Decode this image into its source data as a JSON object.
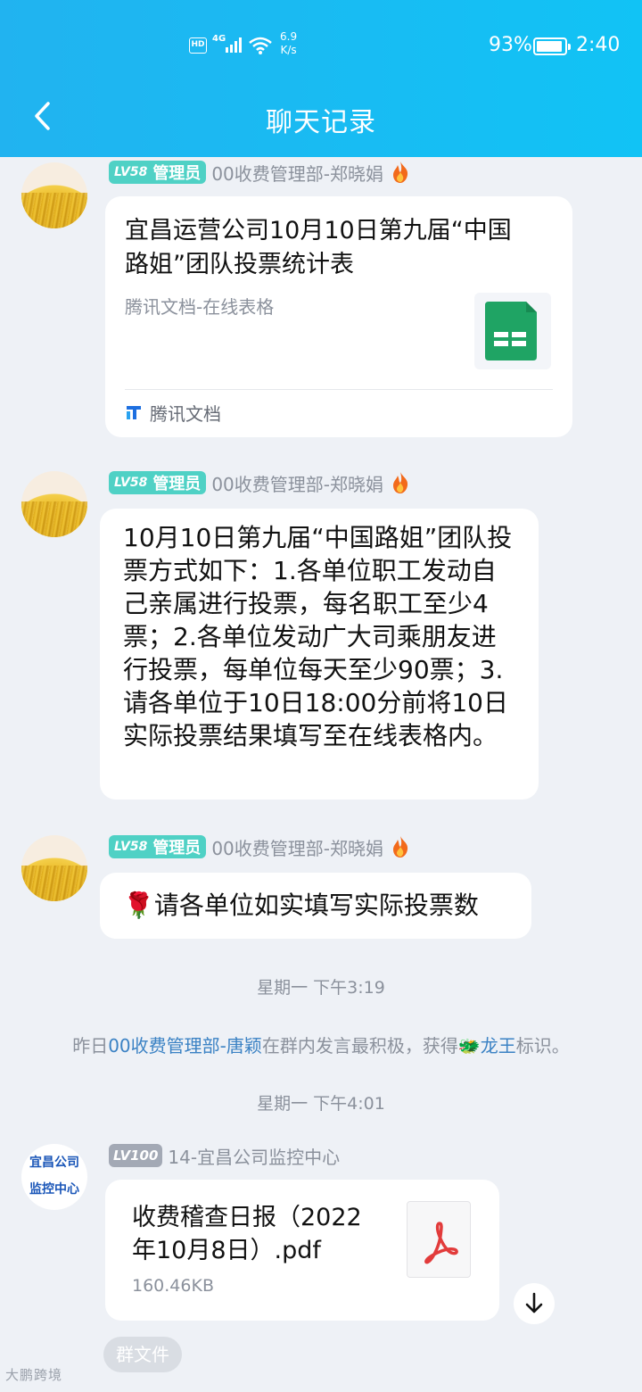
{
  "status_bar": {
    "hd": "HD",
    "network": "4G",
    "speed_value": "6.9",
    "speed_unit": "K/s",
    "battery": "93%",
    "time": "2:40"
  },
  "header": {
    "title": "聊天记录"
  },
  "messages": [
    {
      "sender": {
        "level": "LV58",
        "role": "管理员",
        "name": "00收费管理部-郑晓娟"
      },
      "card": {
        "title": "宜昌运营公司10月10日第九届“中国路姐”团队投票统计表",
        "subtitle": "腾讯文档-在线表格",
        "source": "腾讯文档"
      }
    },
    {
      "sender": {
        "level": "LV58",
        "role": "管理员",
        "name": "00收费管理部-郑晓娟"
      },
      "text": "10月10日第九届“中国路姐”团队投票方式如下：1.各单位职工发动自己亲属进行投票，每名职工至少4票；2.各单位发动广大司乘朋友进行投票，每单位每天至少90票；3.请各单位于10日18:00分前将10日实际投票结果填写至在线表格内。"
    },
    {
      "sender": {
        "level": "LV58",
        "role": "管理员",
        "name": "00收费管理部-郑晓娟"
      },
      "emoji": "🌹",
      "text": "请各单位如实填写实际投票数"
    }
  ],
  "time_1": "星期一 下午3:19",
  "system_notice": {
    "prefix": "昨日",
    "user": "00收费管理部-唐颖",
    "middle": "在群内发言最积极，获得",
    "badge_emoji": "🐲",
    "badge": "龙王",
    "suffix": "标识。"
  },
  "time_2": "星期一 下午4:01",
  "file_message": {
    "avatar_text_line1": "宜昌公司",
    "avatar_text_line2": "监控中心",
    "sender": {
      "level": "LV100",
      "name": "14-宜昌公司监控中心"
    },
    "file_name": "收费稽查日报（2022年10月8日）.pdf",
    "file_size": "160.46KB"
  },
  "group_file_chip": "群文件",
  "watermark": "大鹏跨境"
}
